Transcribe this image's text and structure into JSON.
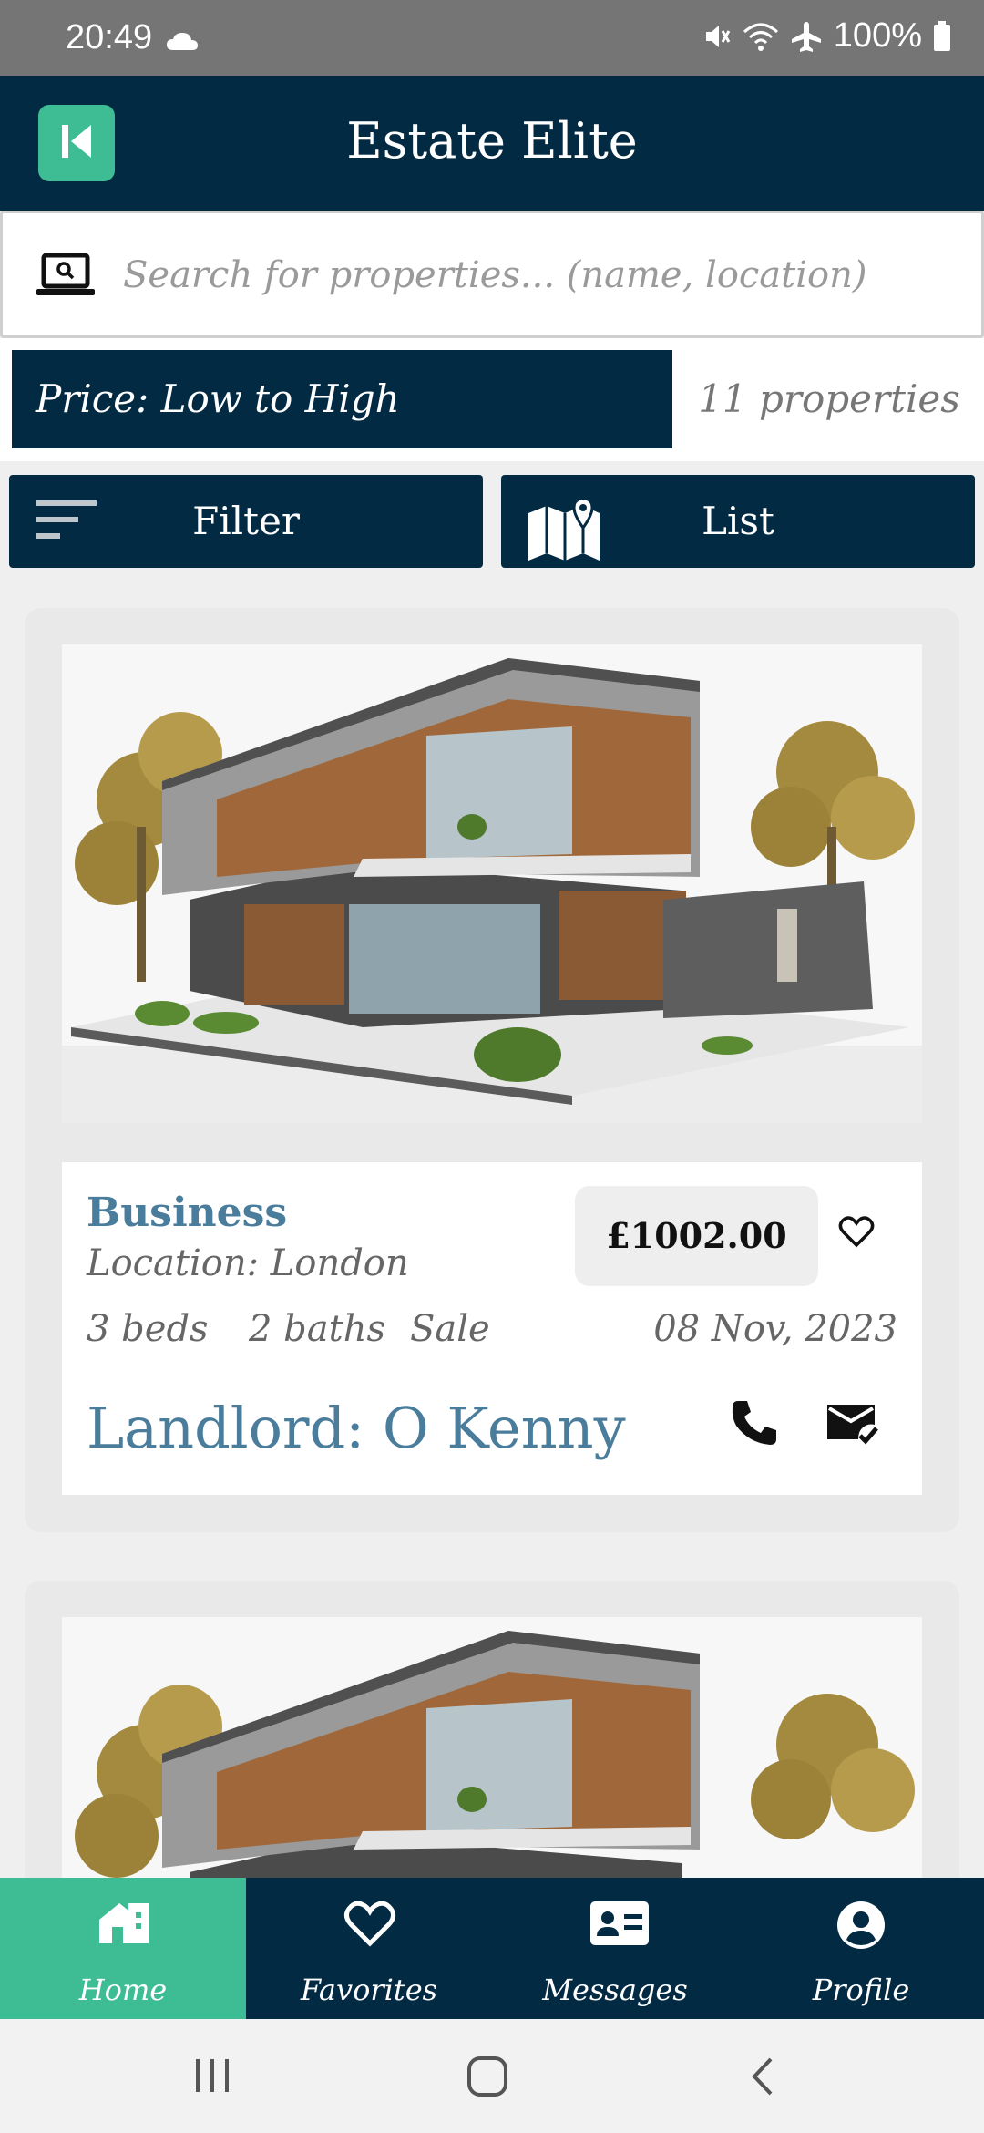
{
  "status_bar": {
    "time": "20:49",
    "battery": "100%"
  },
  "header": {
    "title": "Estate Elite"
  },
  "search": {
    "placeholder": "Search for properties... (name, location)"
  },
  "sort": {
    "selected": "Price: Low to High",
    "count": "11 properties"
  },
  "toolbar": {
    "filter_label": "Filter",
    "list_label": "List"
  },
  "listings": [
    {
      "type": "Business",
      "location": "Location: London",
      "price": "£1002.00",
      "beds": "3 beds",
      "baths": "2 baths",
      "kind": "Sale",
      "date": "08 Nov, 2023",
      "landlord": "Landlord: O Kenny"
    }
  ],
  "bottom_nav": [
    {
      "label": "Home",
      "icon": "home-icon",
      "active": true
    },
    {
      "label": "Favorites",
      "icon": "heart-icon",
      "active": false
    },
    {
      "label": "Messages",
      "icon": "contact-card-icon",
      "active": false
    },
    {
      "label": "Profile",
      "icon": "profile-icon",
      "active": false
    }
  ],
  "colors": {
    "primary": "#032a43",
    "accent": "#3ebd95",
    "link": "#4a7d9c"
  }
}
